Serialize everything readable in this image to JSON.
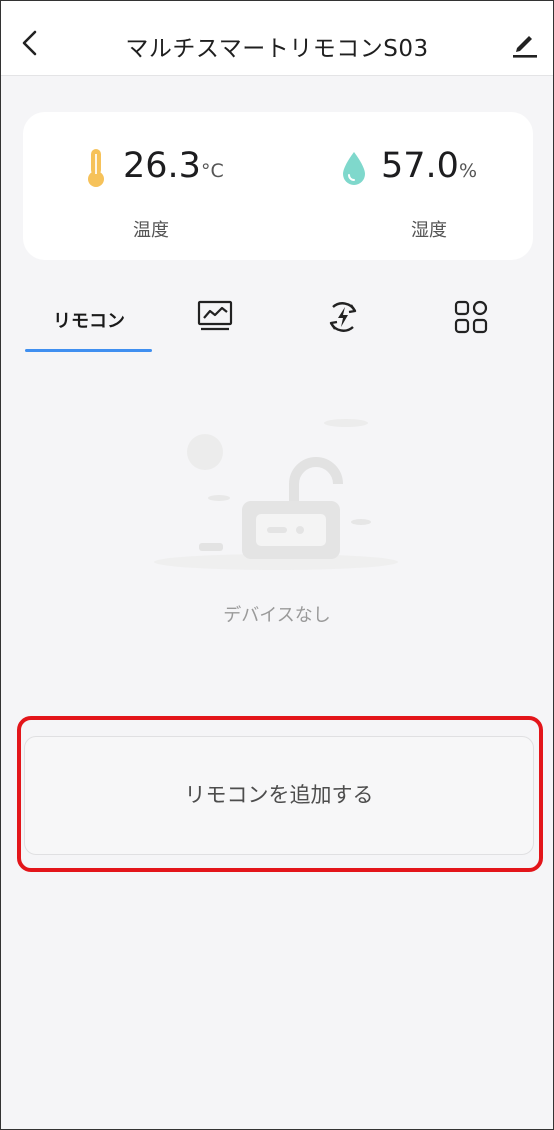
{
  "header": {
    "title": "マルチスマートリモコンS03",
    "back_icon": "chevron-left-icon",
    "edit_icon": "pencil-icon"
  },
  "sensors": {
    "temperature": {
      "value": "26.3",
      "unit": "°C",
      "label": "温度",
      "icon": "thermometer-icon",
      "color": "#f6c25a"
    },
    "humidity": {
      "value": "57.0",
      "unit": "%",
      "label": "湿度",
      "icon": "water-drop-icon",
      "color": "#7fd8cc"
    }
  },
  "tabs": [
    {
      "label": "リモコン",
      "active": true
    },
    {
      "icon": "chart-monitor-icon"
    },
    {
      "icon": "energy-refresh-icon"
    },
    {
      "icon": "grid-apps-icon"
    }
  ],
  "empty_state": {
    "text": "デバイスなし"
  },
  "add_remote": {
    "label": "リモコンを追加する"
  },
  "colors": {
    "accent": "#3f8ff0",
    "highlight": "#e3151a"
  }
}
